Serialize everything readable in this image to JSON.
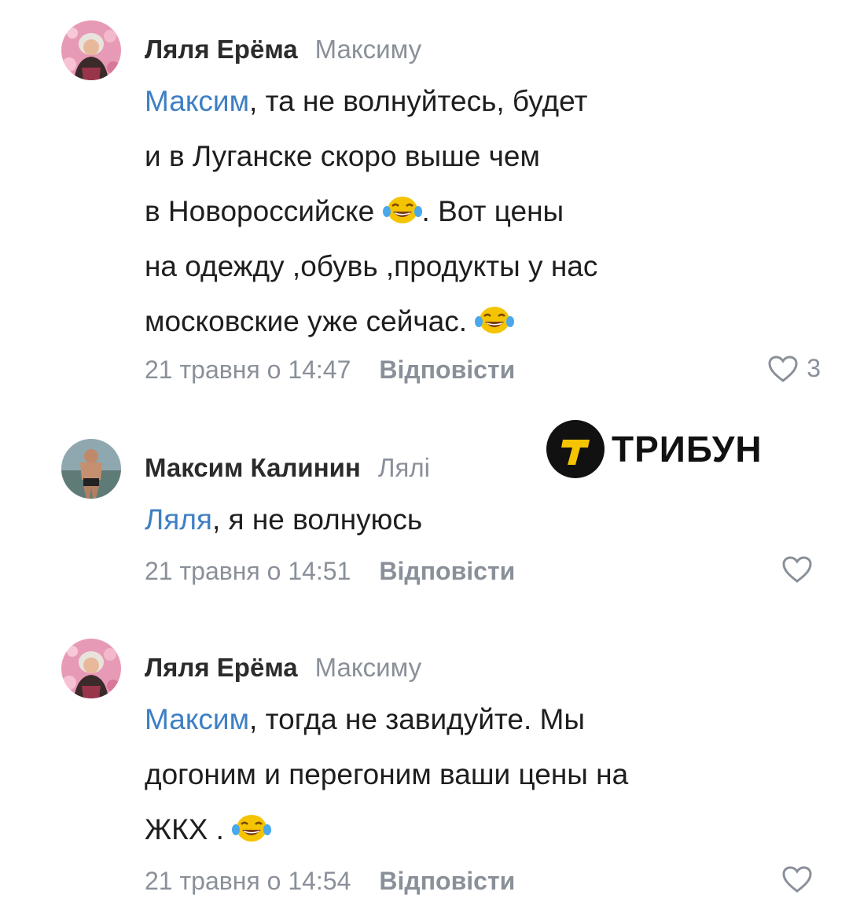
{
  "logo": {
    "text": "ТРИБУН",
    "glyph": "T"
  },
  "comments": [
    {
      "author": "Ляля Ерёма",
      "reply_to": "Максиму",
      "mention": "Максим",
      "lines": [
        ", та не волнуйтесь, будет",
        "и в Луганске скоро   выше чем",
        "в Новороссийске",
        ". Вот цены",
        "на одежду ,обувь ,продукты у нас",
        "московские уже сейчас."
      ],
      "timestamp": "21 травня о 14:47",
      "reply_label": "Відповісти",
      "likes": "3"
    },
    {
      "author": "Максим Калинин",
      "reply_to": "Лялі",
      "mention": "Ляля",
      "lines": [
        ", я не волнуюсь"
      ],
      "timestamp": "21 травня о 14:51",
      "reply_label": "Відповісти",
      "likes": ""
    },
    {
      "author": "Ляля Ерёма",
      "reply_to": "Максиму",
      "mention": "Максим",
      "lines": [
        ", тогда не завидуйте. Мы",
        "догоним и перегоним ваши  цены на",
        "ЖКХ ."
      ],
      "timestamp": "21 травня о 14:54",
      "reply_label": "Відповісти",
      "likes": ""
    }
  ],
  "colors": {
    "mention": "#3e7fc4",
    "meta": "#8a9099",
    "emoji": "#f5c400"
  },
  "icons": {
    "like": "heart-outline-icon",
    "emoji": "laughing-tears-emoji-icon"
  }
}
